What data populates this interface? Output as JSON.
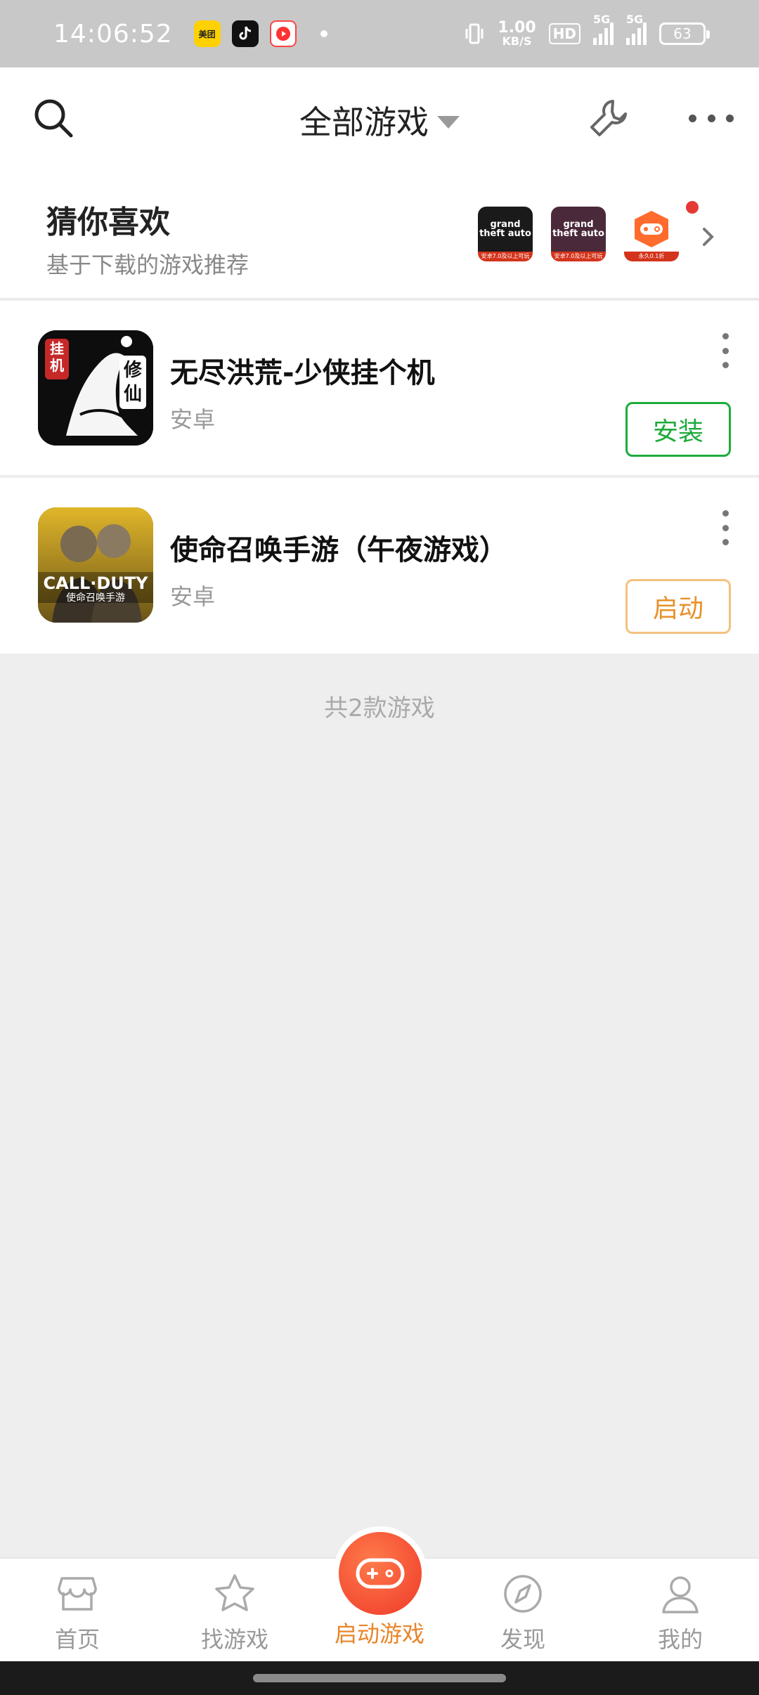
{
  "status_bar": {
    "time": "14:06:52",
    "net_speed_value": "1.00",
    "net_speed_unit": "KB/S",
    "hd_label": "HD",
    "sim1_label": "5G",
    "sim2_label": "5G",
    "battery": "63",
    "notification_apps": [
      "meituan-icon",
      "tiktok-icon",
      "video-app-icon"
    ]
  },
  "header": {
    "title": "全部游戏",
    "icons": [
      "search-icon",
      "wrench-icon",
      "more-icon"
    ]
  },
  "recommend": {
    "title": "猜你喜欢",
    "subtitle": "基于下载的游戏推荐",
    "games": [
      {
        "art": "grand theft auto",
        "band": "安卓7.0及以上可玩"
      },
      {
        "art": "grand theft auto",
        "band": "安卓7.0及以上可玩"
      },
      {
        "art": "",
        "band": "永久0.1折"
      }
    ]
  },
  "games": [
    {
      "name": "无尽洪荒-少侠挂个机",
      "platform": "安卓",
      "action": "安装",
      "icon_text_top": "挂机",
      "icon_text_side": "修仙",
      "accent": "#1eab3b"
    },
    {
      "name": "使命召唤手游（午夜游戏）",
      "platform": "安卓",
      "action": "启动",
      "icon_text_top": "CALL·DUTY",
      "icon_text_side": "使命召唤手游",
      "accent": "#e8912a"
    }
  ],
  "count_text": "共2款游戏",
  "bottom_nav": {
    "items": [
      {
        "label": "首页",
        "icon": "store-icon"
      },
      {
        "label": "找游戏",
        "icon": "star-icon"
      },
      {
        "label": "启动游戏",
        "icon": "gamepad-icon"
      },
      {
        "label": "发现",
        "icon": "compass-icon"
      },
      {
        "label": "我的",
        "icon": "person-icon"
      }
    ],
    "active_index": 2,
    "active_color": "#e8852a"
  }
}
